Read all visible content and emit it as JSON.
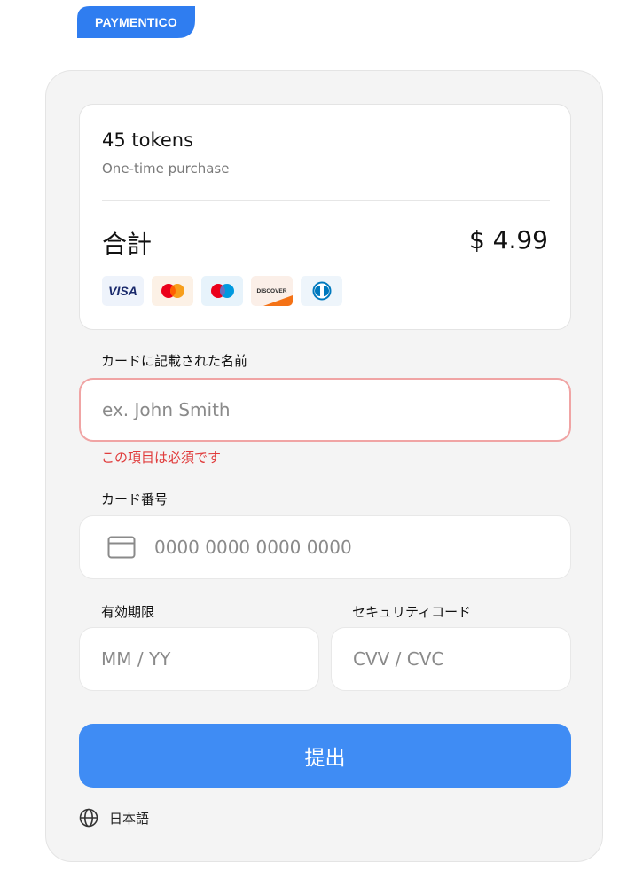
{
  "brand": {
    "name": "PAYMENTICO",
    "color": "#2f7df0"
  },
  "order": {
    "title": "45 tokens",
    "subtitle": "One-time purchase",
    "total_label": "合計",
    "total_price": "$ 4.99"
  },
  "payment_methods": [
    {
      "name": "visa",
      "label": "VISA"
    },
    {
      "name": "mastercard",
      "label": ""
    },
    {
      "name": "maestro",
      "label": ""
    },
    {
      "name": "discover",
      "label": "DISCOVER"
    },
    {
      "name": "diners-club",
      "label": ""
    }
  ],
  "form": {
    "name_label": "カードに記載された名前",
    "name_placeholder": "ex. John Smith",
    "name_error": "この項目は必須です",
    "card_label": "カード番号",
    "card_placeholder": "0000 0000 0000 0000",
    "expiry_label": "有効期限",
    "expiry_placeholder": "MM / YY",
    "cvv_label": "セキュリティコード",
    "cvv_placeholder": "CVV / CVC",
    "submit_label": "提出"
  },
  "language": {
    "icon": "globe-icon",
    "label": "日本語"
  },
  "colors": {
    "accent": "#3f8cf4",
    "error": "#e03b3b",
    "error_border": "#f0a4a4",
    "panel": "#f4f4f4"
  }
}
